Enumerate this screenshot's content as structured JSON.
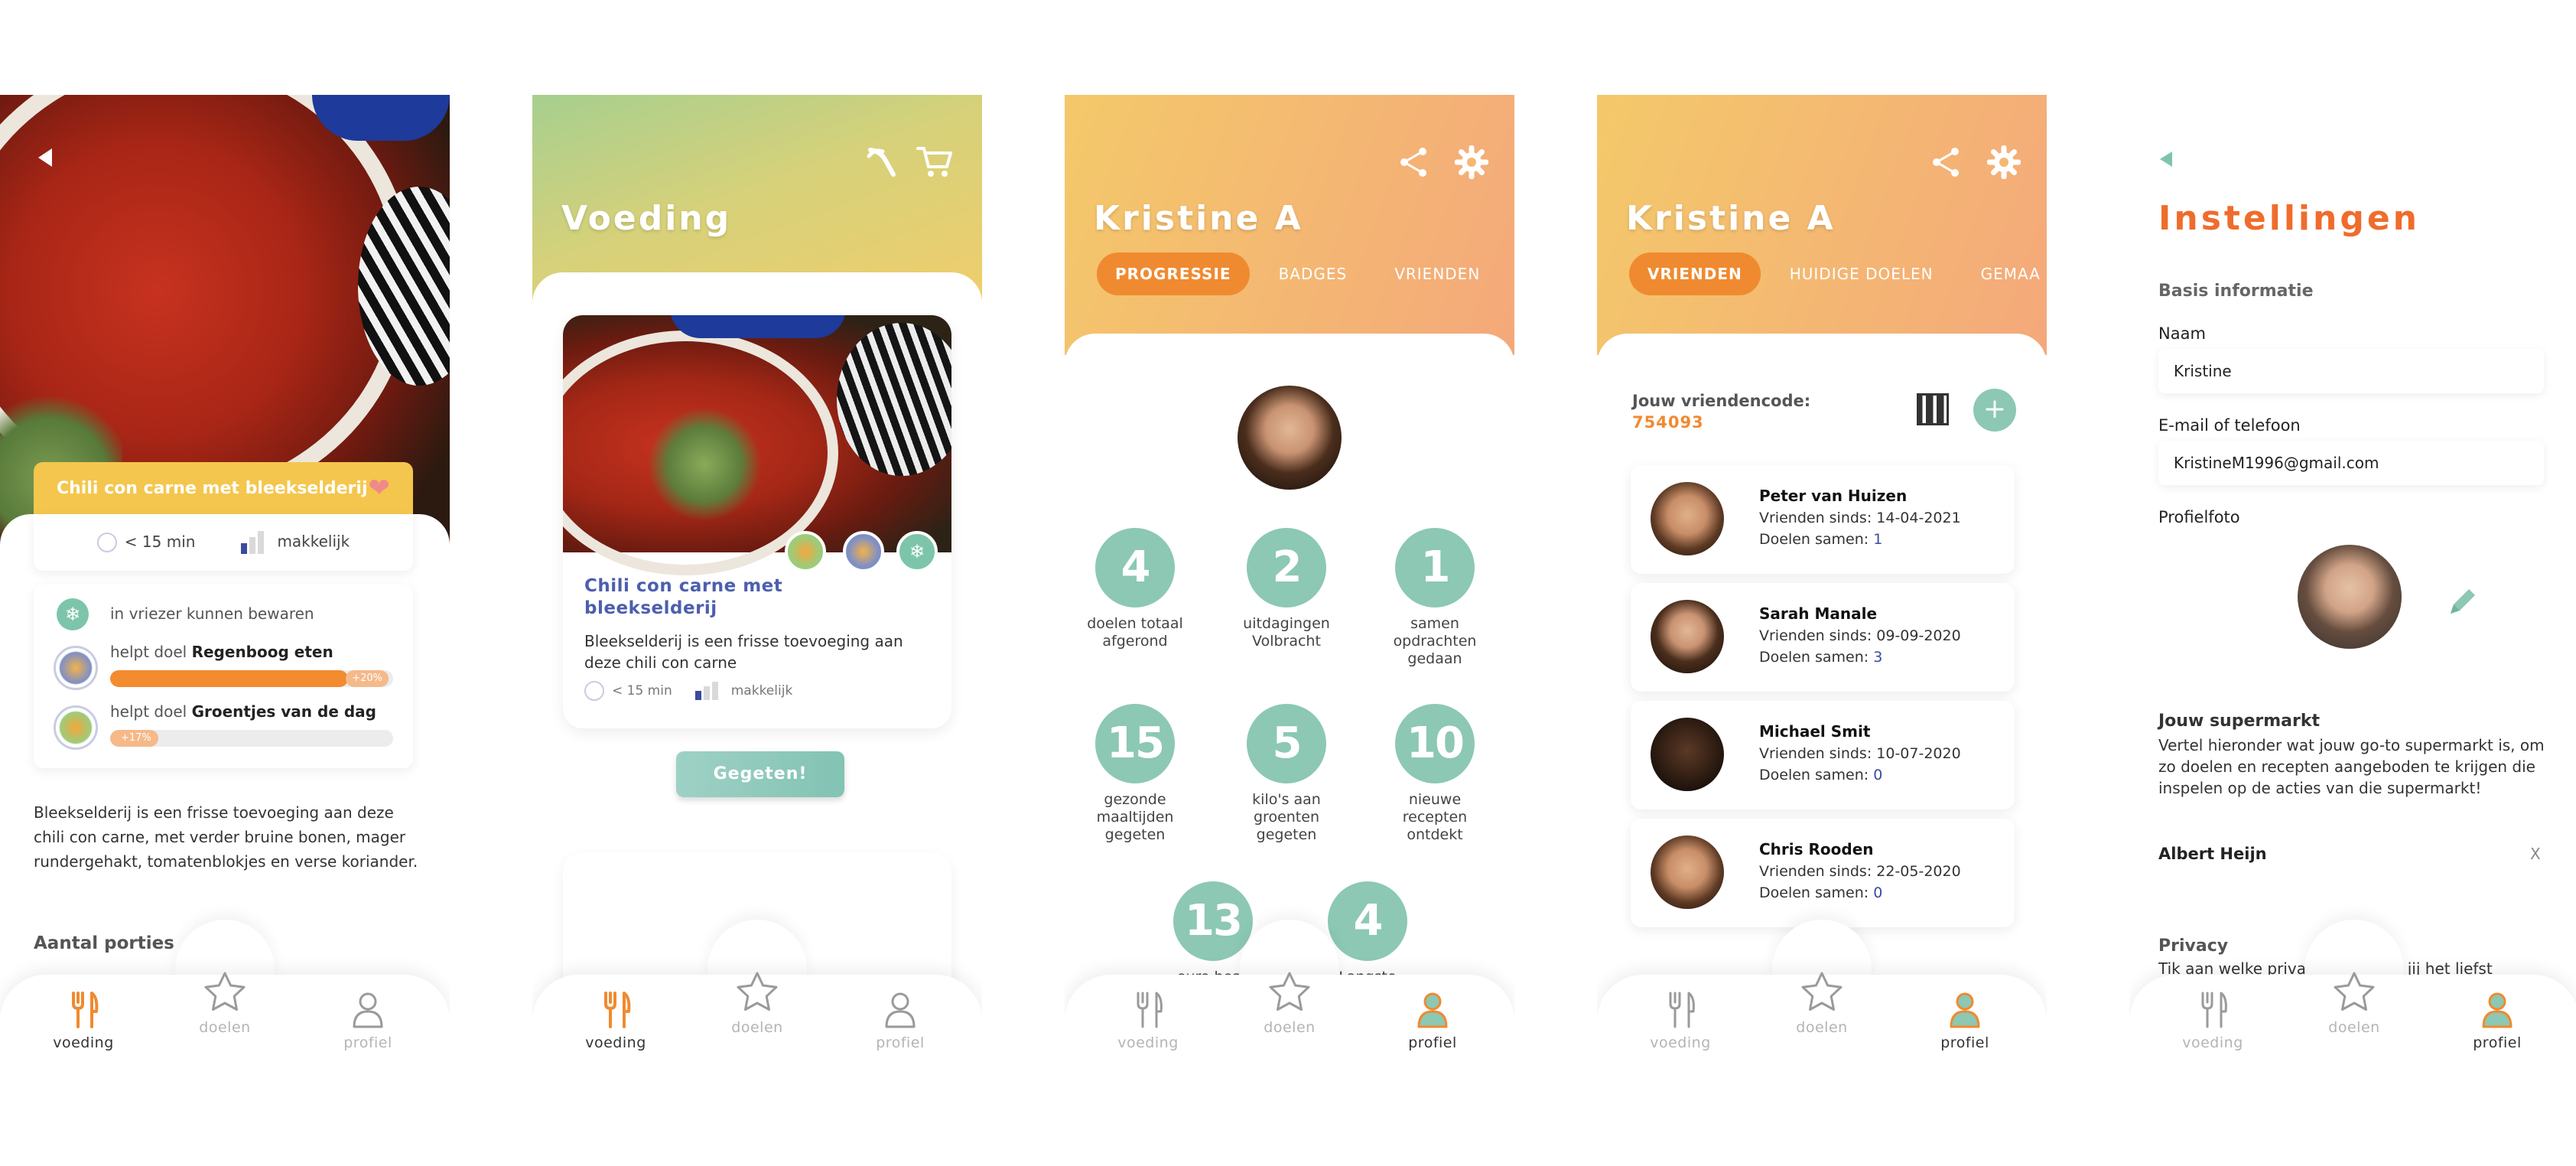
{
  "colors": {
    "orange": "#f08a30",
    "teal": "#8cc8b3",
    "yellow": "#f4c64d",
    "navy": "#3b4a9c",
    "settings_orange": "#ef6c2c"
  },
  "nav": {
    "food": "voeding",
    "goals": "doelen",
    "profile": "profiel"
  },
  "recipe": {
    "title": "Chili con carne met bleekselderij",
    "time": "< 15 min",
    "difficulty": "makkelijk",
    "freezer": "in vriezer kunnen bewaren",
    "goal1_prefix": "helpt doel",
    "goal1_name": "Regenboog eten",
    "goal1_tag": "+20%",
    "goal1_progress": 0.84,
    "goal2_prefix": "helpt doel",
    "goal2_name": "Groentjes van de dag",
    "goal2_tag": "+17%",
    "goal2_progress": 0.17,
    "description": "Bleekselderij is een frisse toevoeging aan deze chili con carne, met verder bruine bonen, mager rundergehakt, tomatenblokjes en verse koriander.",
    "portions_label": "Aantal porties"
  },
  "voeding": {
    "title": "Voeding",
    "card_title": "Chili con carne met bleekselderij",
    "card_desc": "Bleekselderij is een frisse toevoeging aan deze chili con carne",
    "time": "< 15 min",
    "difficulty": "makkelijk",
    "eaten_button": "Gegeten!"
  },
  "profile": {
    "name": "Kristine A",
    "tabs": [
      "PROGRESSIE",
      "BADGES",
      "VRIENDEN"
    ],
    "stats": [
      {
        "value": "4",
        "label": "doelen totaal afgerond"
      },
      {
        "value": "2",
        "label": "uitdagingen Volbracht"
      },
      {
        "value": "1",
        "label": "samen opdrachten gedaan"
      },
      {
        "value": "15",
        "label": "gezonde maaltijden gegeten"
      },
      {
        "value": "5",
        "label": "kilo's aan groenten gegeten"
      },
      {
        "value": "10",
        "label": "nieuwe recepten ontdekt"
      },
      {
        "value": "13",
        "label": "euro besp"
      },
      {
        "value": "4",
        "label": "Langste"
      }
    ]
  },
  "friends": {
    "name": "Kristine A",
    "tabs": [
      "VRIENDEN",
      "HUIDIGE DOELEN",
      "GEMAA"
    ],
    "code_label": "Jouw vriendencode:",
    "code": "754093",
    "list": [
      {
        "name": "Peter van Huizen",
        "since": "Vrienden sinds: 14-04-2021",
        "goals_label": "Doelen samen:",
        "goals": "1"
      },
      {
        "name": "Sarah Manale",
        "since": "Vrienden sinds: 09-09-2020",
        "goals_label": "Doelen samen:",
        "goals": "3"
      },
      {
        "name": "Michael Smit",
        "since": "Vrienden sinds: 10-07-2020",
        "goals_label": "Doelen samen:",
        "goals": "0"
      },
      {
        "name": "Chris Rooden",
        "since": "Vrienden sinds: 22-05-2020",
        "goals_label": "Doelen samen:",
        "goals": "0"
      }
    ]
  },
  "settings": {
    "title": "Instellingen",
    "basic_info": "Basis informatie",
    "name_label": "Naam",
    "name_value": "Kristine",
    "email_label": "E-mail of telefoon",
    "email_value": "KristineM1996@gmail.com",
    "photo_label": "Profielfoto",
    "supermarket_title": "Jouw supermarkt",
    "supermarket_desc": "Vertel hieronder wat jouw go-to supermarkt is, om zo doelen en recepten aangeboden te krijgen die inspelen op de acties van die supermarkt!",
    "supermarket_name": "Albert Heijn",
    "remove": "X",
    "privacy_title": "Privacy",
    "privacy_desc": "Tik aan welke privacy gegevens jij het liefst"
  }
}
